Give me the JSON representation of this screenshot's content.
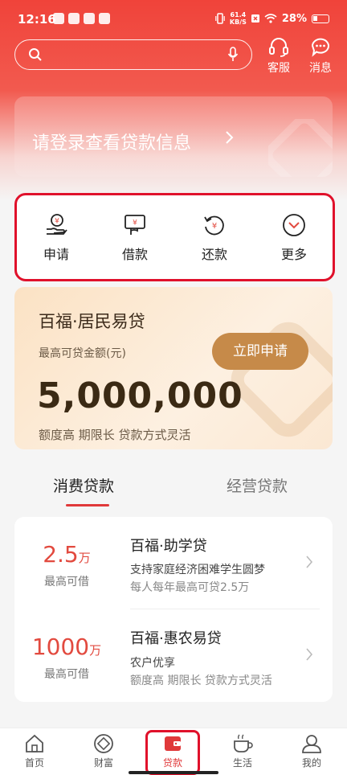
{
  "status_bar": {
    "time": "12:16",
    "net_speed": "61.4",
    "net_unit": "KB/S",
    "battery": "28%"
  },
  "header": {
    "service_label": "客服",
    "message_label": "消息"
  },
  "search": {
    "placeholder": ""
  },
  "login_card": {
    "text": "请登录查看贷款信息"
  },
  "quick_actions": [
    {
      "label": "申请",
      "icon": "apply-icon"
    },
    {
      "label": "借款",
      "icon": "borrow-icon"
    },
    {
      "label": "还款",
      "icon": "repay-icon"
    },
    {
      "label": "更多",
      "icon": "more-icon"
    }
  ],
  "promo": {
    "title": "百福·居民易贷",
    "subtitle": "最高可贷金额(元)",
    "amount": "5,000,000",
    "features": "额度高 期限长 贷款方式灵活",
    "apply_button": "立即申请"
  },
  "tabs": [
    {
      "label": "消费贷款",
      "active": true
    },
    {
      "label": "经营贷款",
      "active": false
    }
  ],
  "products": [
    {
      "amount": "2.5",
      "unit": "万",
      "caption": "最高可借",
      "name": "百福·助学贷",
      "desc1": "支持家庭经济困难学生圆梦",
      "desc2": "每人每年最高可贷2.5万"
    },
    {
      "amount": "1000",
      "unit": "万",
      "caption": "最高可借",
      "name": "百福·惠农易贷",
      "desc1": "农户优享",
      "desc2": "额度高 期限长 贷款方式灵活"
    }
  ],
  "bottom_nav": [
    {
      "label": "首页",
      "icon": "home-icon"
    },
    {
      "label": "财富",
      "icon": "wealth-icon"
    },
    {
      "label": "贷款",
      "icon": "loan-icon",
      "active": true
    },
    {
      "label": "生活",
      "icon": "life-icon"
    },
    {
      "label": "我的",
      "icon": "profile-icon"
    }
  ],
  "colors": {
    "brand_red": "#f0433a",
    "accent_gold": "#c68a49",
    "highlight": "#e0112b"
  }
}
